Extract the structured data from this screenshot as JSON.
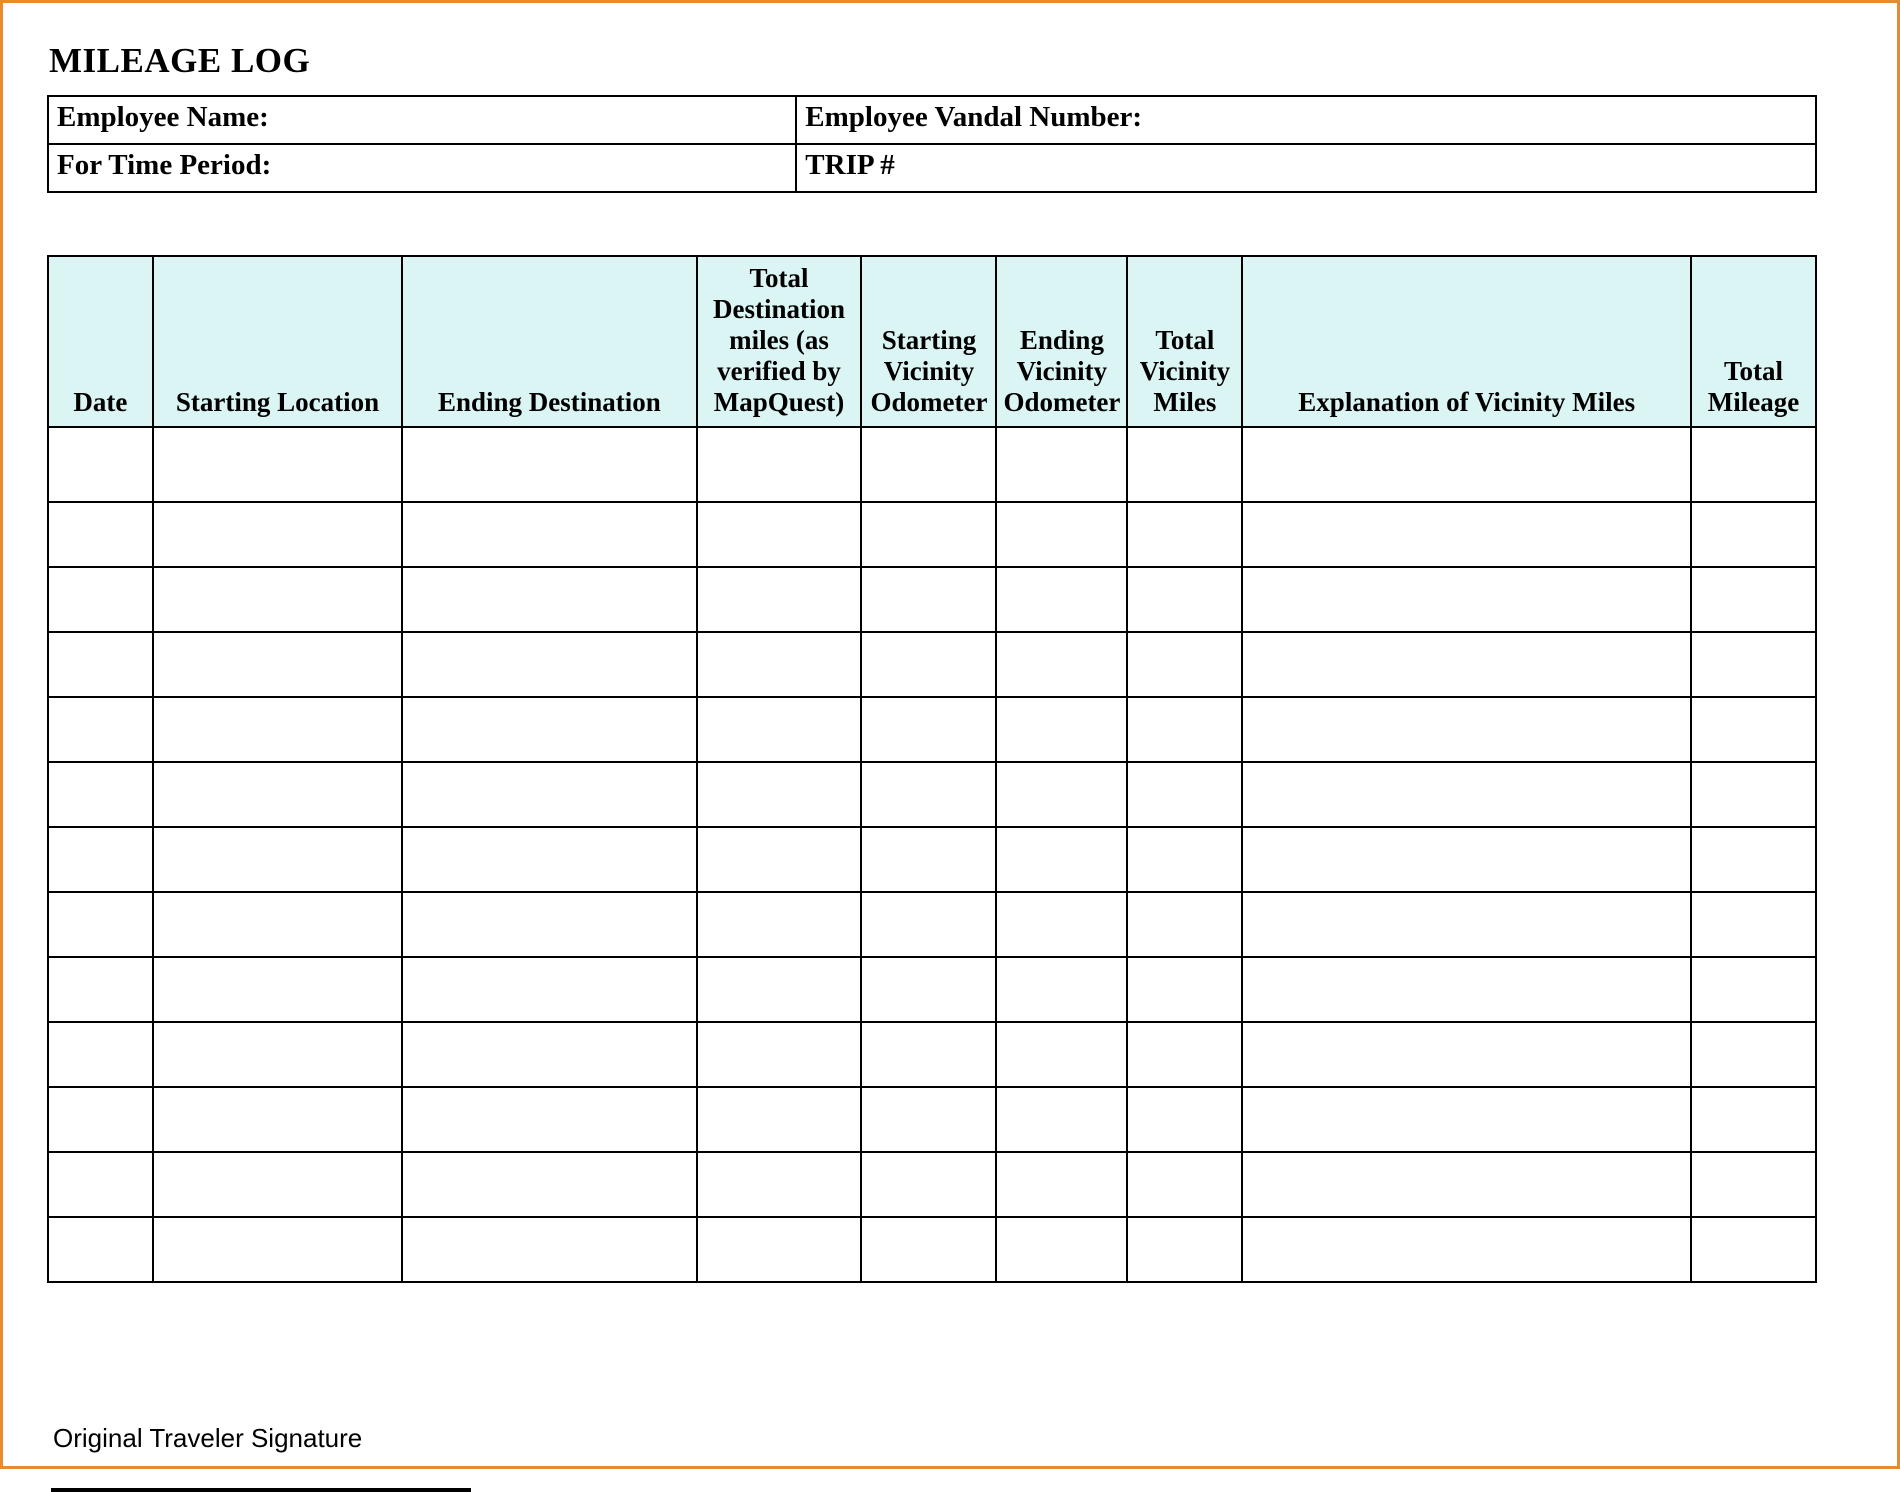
{
  "title": "MILEAGE LOG",
  "info": {
    "employee_name_label": "Employee Name:",
    "employee_vandal_label": "Employee Vandal Number:",
    "time_period_label": "For Time Period:",
    "trip_label": "TRIP #"
  },
  "columns": {
    "date": "Date",
    "starting_location": "Starting Location",
    "ending_destination": "Ending Destination",
    "total_destination_miles": "Total Destination miles (as verified by MapQuest)",
    "starting_vicinity_odometer": "Starting Vicinity Odometer",
    "ending_vicinity_odometer": "Ending Vicinity Odometer",
    "total_vicinity_miles": "Total Vicinity Miles",
    "explanation": "Explanation of Vicinity Miles",
    "total_mileage": "Total Mileage"
  },
  "rows": [
    {
      "date": "",
      "starting_location": "",
      "ending_destination": "",
      "total_destination_miles": "",
      "starting_vicinity_odometer": "",
      "ending_vicinity_odometer": "",
      "total_vicinity_miles": "",
      "explanation": "",
      "total_mileage": ""
    },
    {
      "date": "",
      "starting_location": "",
      "ending_destination": "",
      "total_destination_miles": "",
      "starting_vicinity_odometer": "",
      "ending_vicinity_odometer": "",
      "total_vicinity_miles": "",
      "explanation": "",
      "total_mileage": ""
    },
    {
      "date": "",
      "starting_location": "",
      "ending_destination": "",
      "total_destination_miles": "",
      "starting_vicinity_odometer": "",
      "ending_vicinity_odometer": "",
      "total_vicinity_miles": "",
      "explanation": "",
      "total_mileage": ""
    },
    {
      "date": "",
      "starting_location": "",
      "ending_destination": "",
      "total_destination_miles": "",
      "starting_vicinity_odometer": "",
      "ending_vicinity_odometer": "",
      "total_vicinity_miles": "",
      "explanation": "",
      "total_mileage": ""
    },
    {
      "date": "",
      "starting_location": "",
      "ending_destination": "",
      "total_destination_miles": "",
      "starting_vicinity_odometer": "",
      "ending_vicinity_odometer": "",
      "total_vicinity_miles": "",
      "explanation": "",
      "total_mileage": ""
    },
    {
      "date": "",
      "starting_location": "",
      "ending_destination": "",
      "total_destination_miles": "",
      "starting_vicinity_odometer": "",
      "ending_vicinity_odometer": "",
      "total_vicinity_miles": "",
      "explanation": "",
      "total_mileage": ""
    },
    {
      "date": "",
      "starting_location": "",
      "ending_destination": "",
      "total_destination_miles": "",
      "starting_vicinity_odometer": "",
      "ending_vicinity_odometer": "",
      "total_vicinity_miles": "",
      "explanation": "",
      "total_mileage": ""
    },
    {
      "date": "",
      "starting_location": "",
      "ending_destination": "",
      "total_destination_miles": "",
      "starting_vicinity_odometer": "",
      "ending_vicinity_odometer": "",
      "total_vicinity_miles": "",
      "explanation": "",
      "total_mileage": ""
    },
    {
      "date": "",
      "starting_location": "",
      "ending_destination": "",
      "total_destination_miles": "",
      "starting_vicinity_odometer": "",
      "ending_vicinity_odometer": "",
      "total_vicinity_miles": "",
      "explanation": "",
      "total_mileage": ""
    },
    {
      "date": "",
      "starting_location": "",
      "ending_destination": "",
      "total_destination_miles": "",
      "starting_vicinity_odometer": "",
      "ending_vicinity_odometer": "",
      "total_vicinity_miles": "",
      "explanation": "",
      "total_mileage": ""
    },
    {
      "date": "",
      "starting_location": "",
      "ending_destination": "",
      "total_destination_miles": "",
      "starting_vicinity_odometer": "",
      "ending_vicinity_odometer": "",
      "total_vicinity_miles": "",
      "explanation": "",
      "total_mileage": ""
    },
    {
      "date": "",
      "starting_location": "",
      "ending_destination": "",
      "total_destination_miles": "",
      "starting_vicinity_odometer": "",
      "ending_vicinity_odometer": "",
      "total_vicinity_miles": "",
      "explanation": "",
      "total_mileage": ""
    },
    {
      "date": "",
      "starting_location": "",
      "ending_destination": "",
      "total_destination_miles": "",
      "starting_vicinity_odometer": "",
      "ending_vicinity_odometer": "",
      "total_vicinity_miles": "",
      "explanation": "",
      "total_mileage": ""
    }
  ],
  "signature_label": "Original Traveler Signature"
}
